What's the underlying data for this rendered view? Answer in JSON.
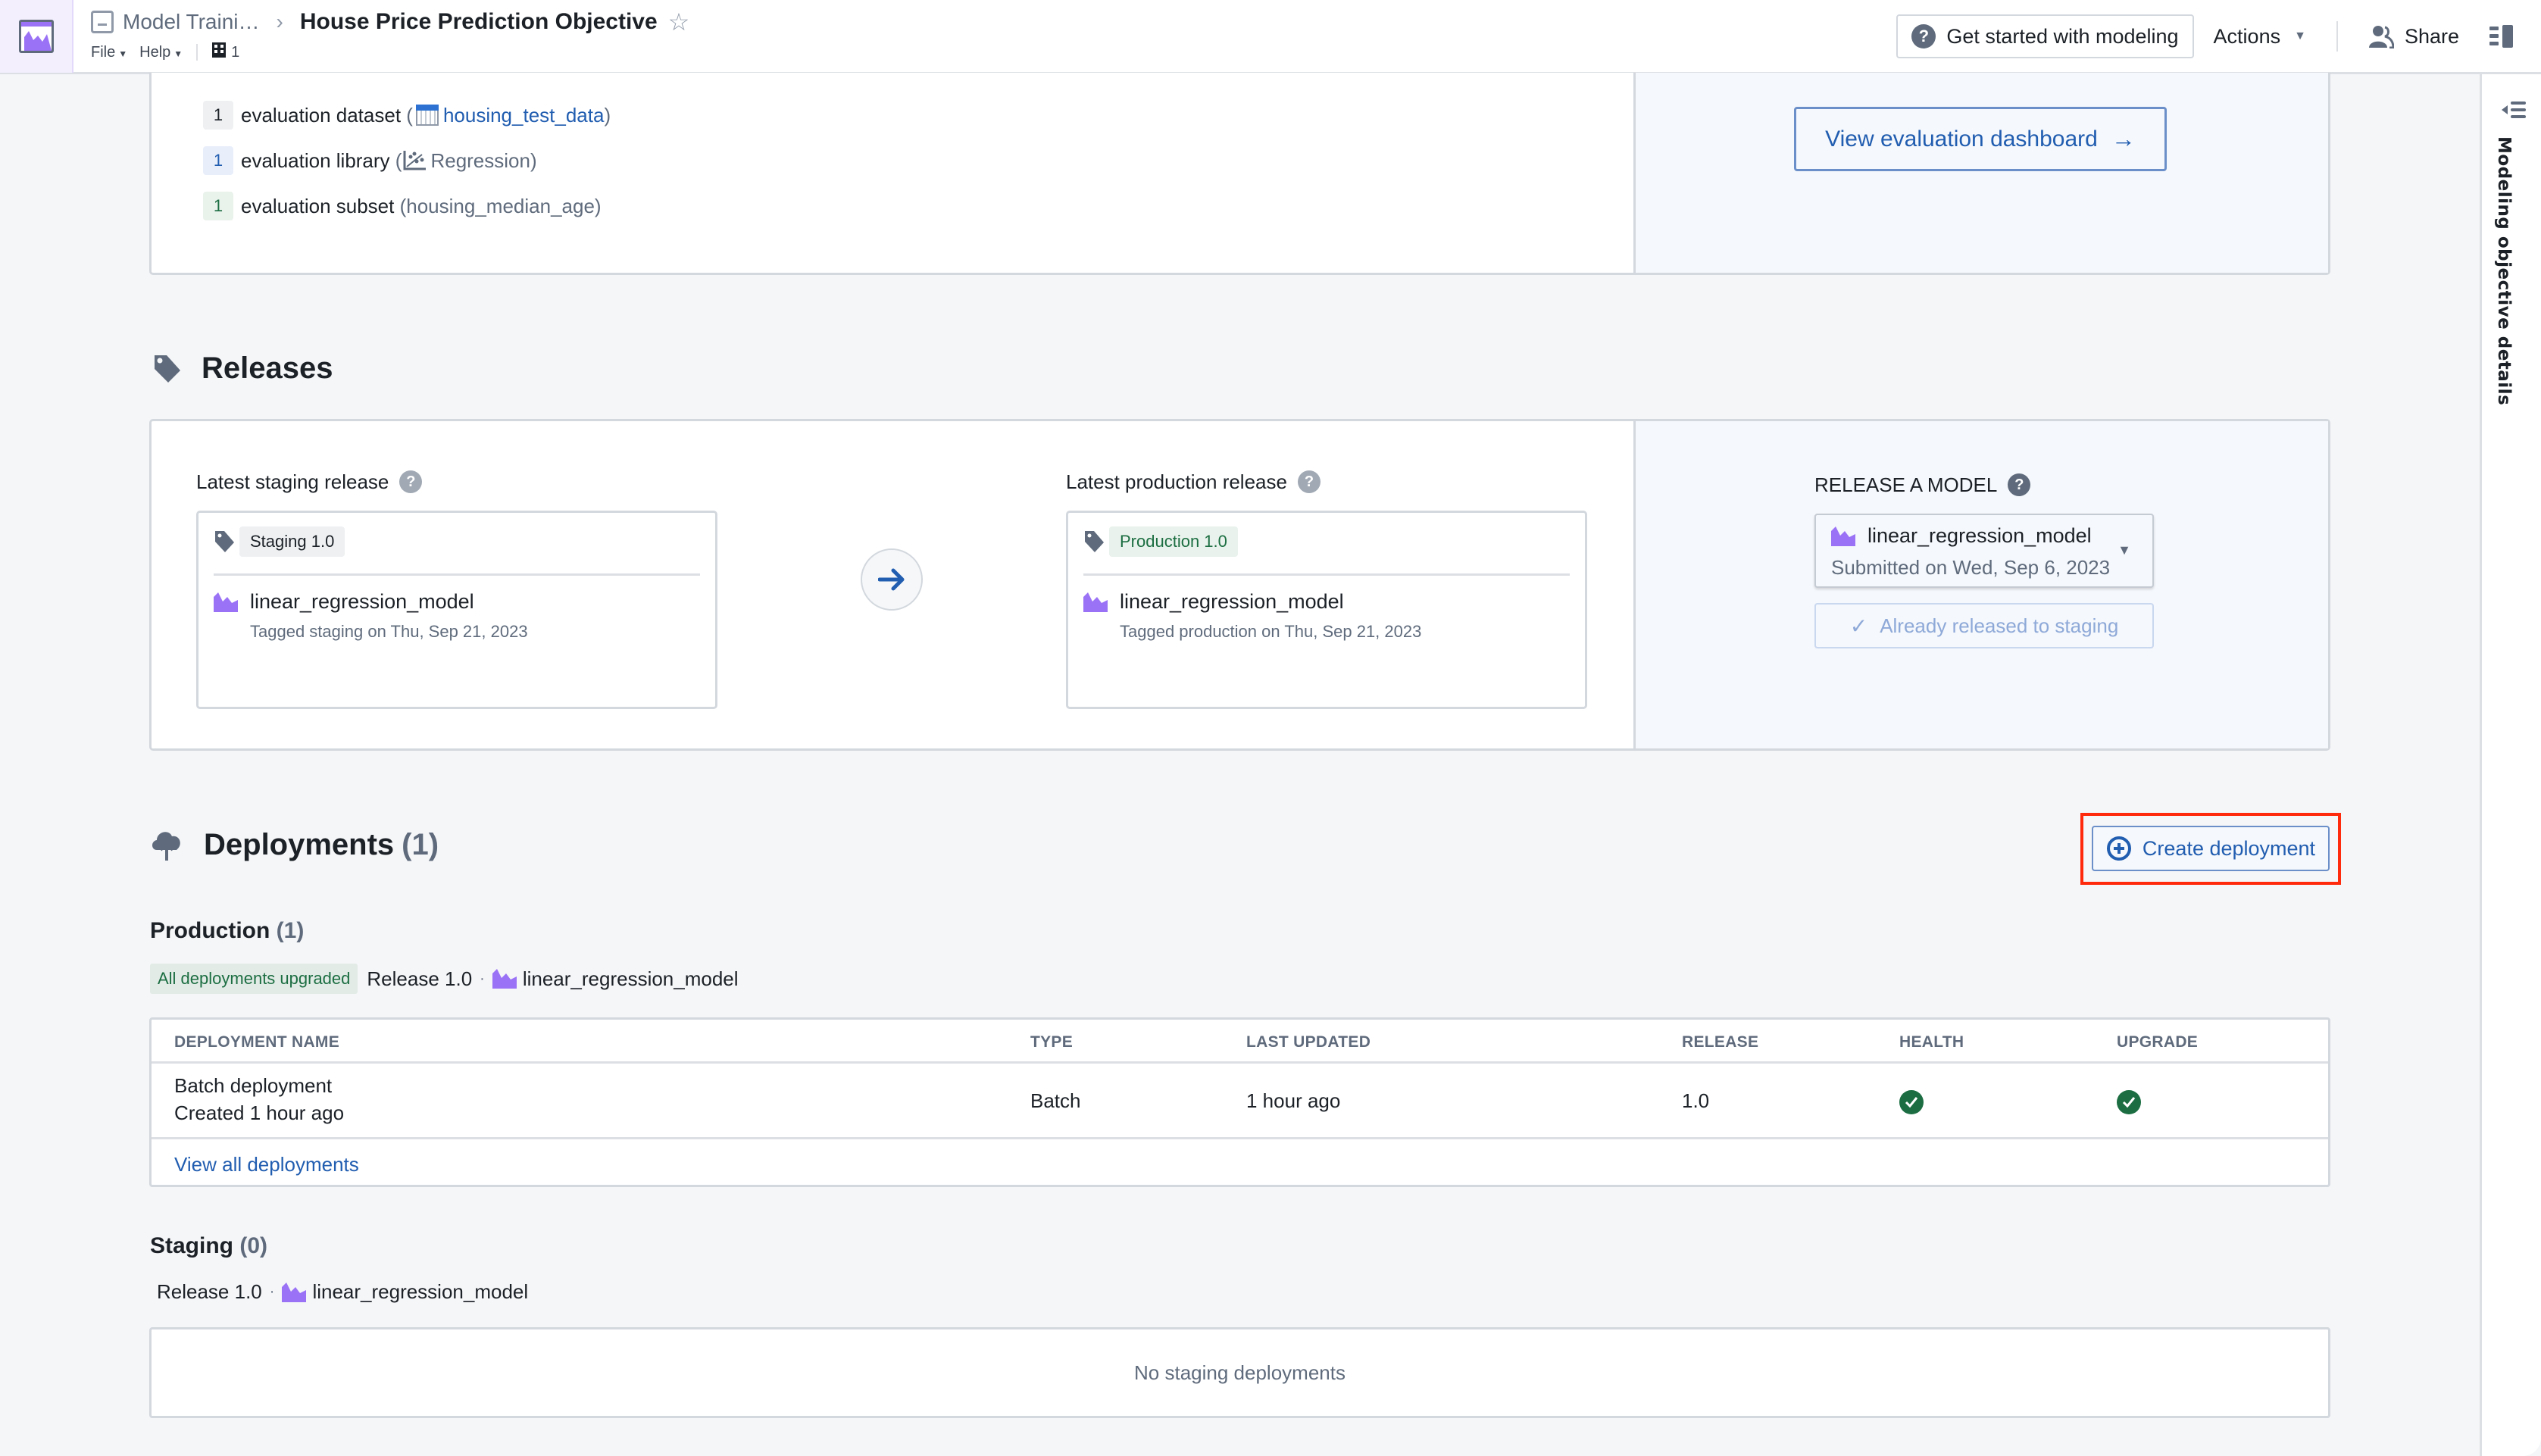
{
  "topbar": {
    "breadcrumb_parent": "Model Traini…",
    "title": "House Price Prediction Objective",
    "menus": [
      "File",
      "Help"
    ],
    "resource_count": "1",
    "get_started_label": "Get started with modeling",
    "actions_label": "Actions",
    "share_label": "Share"
  },
  "right_panel": {
    "label": "Modeling objective details"
  },
  "evaluation": {
    "items": [
      {
        "count": "1",
        "label": "evaluation dataset",
        "value": "housing_test_data"
      },
      {
        "count": "1",
        "label": "evaluation library",
        "value": "Regression"
      },
      {
        "count": "1",
        "label": "evaluation subset",
        "value": "housing_median_age"
      }
    ],
    "dashboard_button": "View evaluation dashboard"
  },
  "releases": {
    "title": "Releases",
    "staging": {
      "label": "Latest staging release",
      "tag": "Staging 1.0",
      "model": "linear_regression_model",
      "subtitle": "Tagged staging on Thu, Sep 21, 2023"
    },
    "production": {
      "label": "Latest production release",
      "tag": "Production 1.0",
      "model": "linear_regression_model",
      "subtitle": "Tagged production on Thu, Sep 21, 2023"
    },
    "release_model": {
      "label": "RELEASE A MODEL",
      "selected_model": "linear_regression_model",
      "selected_sub": "Submitted on Wed, Sep 6, 2023",
      "button": "Already released to staging"
    }
  },
  "deployments": {
    "title": "Deployments",
    "count": "(1)",
    "create_button": "Create deployment",
    "production": {
      "title": "Production",
      "count": "(1)",
      "badge": "All deployments upgraded",
      "release": "Release 1.0",
      "model": "linear_regression_model",
      "columns": [
        "DEPLOYMENT NAME",
        "TYPE",
        "LAST UPDATED",
        "RELEASE",
        "HEALTH",
        "UPGRADE"
      ],
      "rows": [
        {
          "name": "Batch deployment",
          "created": "Created 1 hour ago",
          "type": "Batch",
          "last_updated": "1 hour ago",
          "release": "1.0",
          "health": "healthy",
          "upgrade": "upgraded"
        }
      ],
      "view_all": "View all deployments"
    },
    "staging": {
      "title": "Staging",
      "count": "(0)",
      "release": "Release 1.0",
      "model": "linear_regression_model",
      "empty_text": "No staging deployments"
    }
  },
  "colors": {
    "accent": "#215db0",
    "success": "#1c6e42",
    "model_icon": "#9a72f5",
    "highlight": "#ff2a0c"
  }
}
